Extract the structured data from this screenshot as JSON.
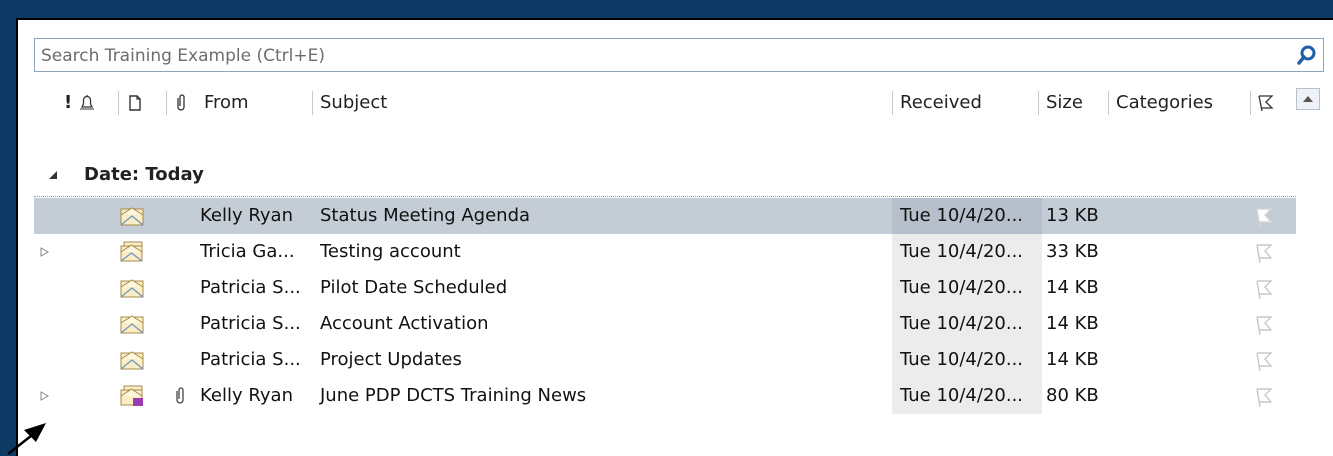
{
  "search": {
    "placeholder": "Search Training Example (Ctrl+E)"
  },
  "columns": {
    "importance": "!",
    "from": "From",
    "subject": "Subject",
    "received": "Received",
    "size": "Size",
    "categories": "Categories"
  },
  "group": {
    "label": "Date: Today"
  },
  "messages": [
    {
      "from": "Kelly Ryan",
      "subject": "Status Meeting Agenda",
      "received": "Tue 10/4/20...",
      "size": "13 KB"
    },
    {
      "from": "Tricia Ga...",
      "subject": "Testing account",
      "received": "Tue 10/4/20...",
      "size": "33 KB"
    },
    {
      "from": "Patricia S...",
      "subject": "Pilot Date Scheduled",
      "received": "Tue 10/4/20...",
      "size": "14 KB"
    },
    {
      "from": "Patricia S...",
      "subject": "Account Activation",
      "received": "Tue 10/4/20...",
      "size": "14 KB"
    },
    {
      "from": "Patricia S...",
      "subject": "Project Updates",
      "received": "Tue 10/4/20...",
      "size": "14 KB"
    },
    {
      "from": "Kelly Ryan",
      "subject": "June PDP DCTS Training News",
      "received": "Tue 10/4/20...",
      "size": "80 KB"
    }
  ],
  "colors": {
    "selected_row": "#c4ccd6",
    "search_icon": "#1f5fa8",
    "accent_bg": "#0e3a66"
  },
  "icons": [
    "search-icon",
    "reminder-bell-icon",
    "document-icon",
    "attachment-icon",
    "flag-icon",
    "envelope-icon",
    "expander-icon",
    "collapse-icon",
    "scroll-up-icon"
  ]
}
